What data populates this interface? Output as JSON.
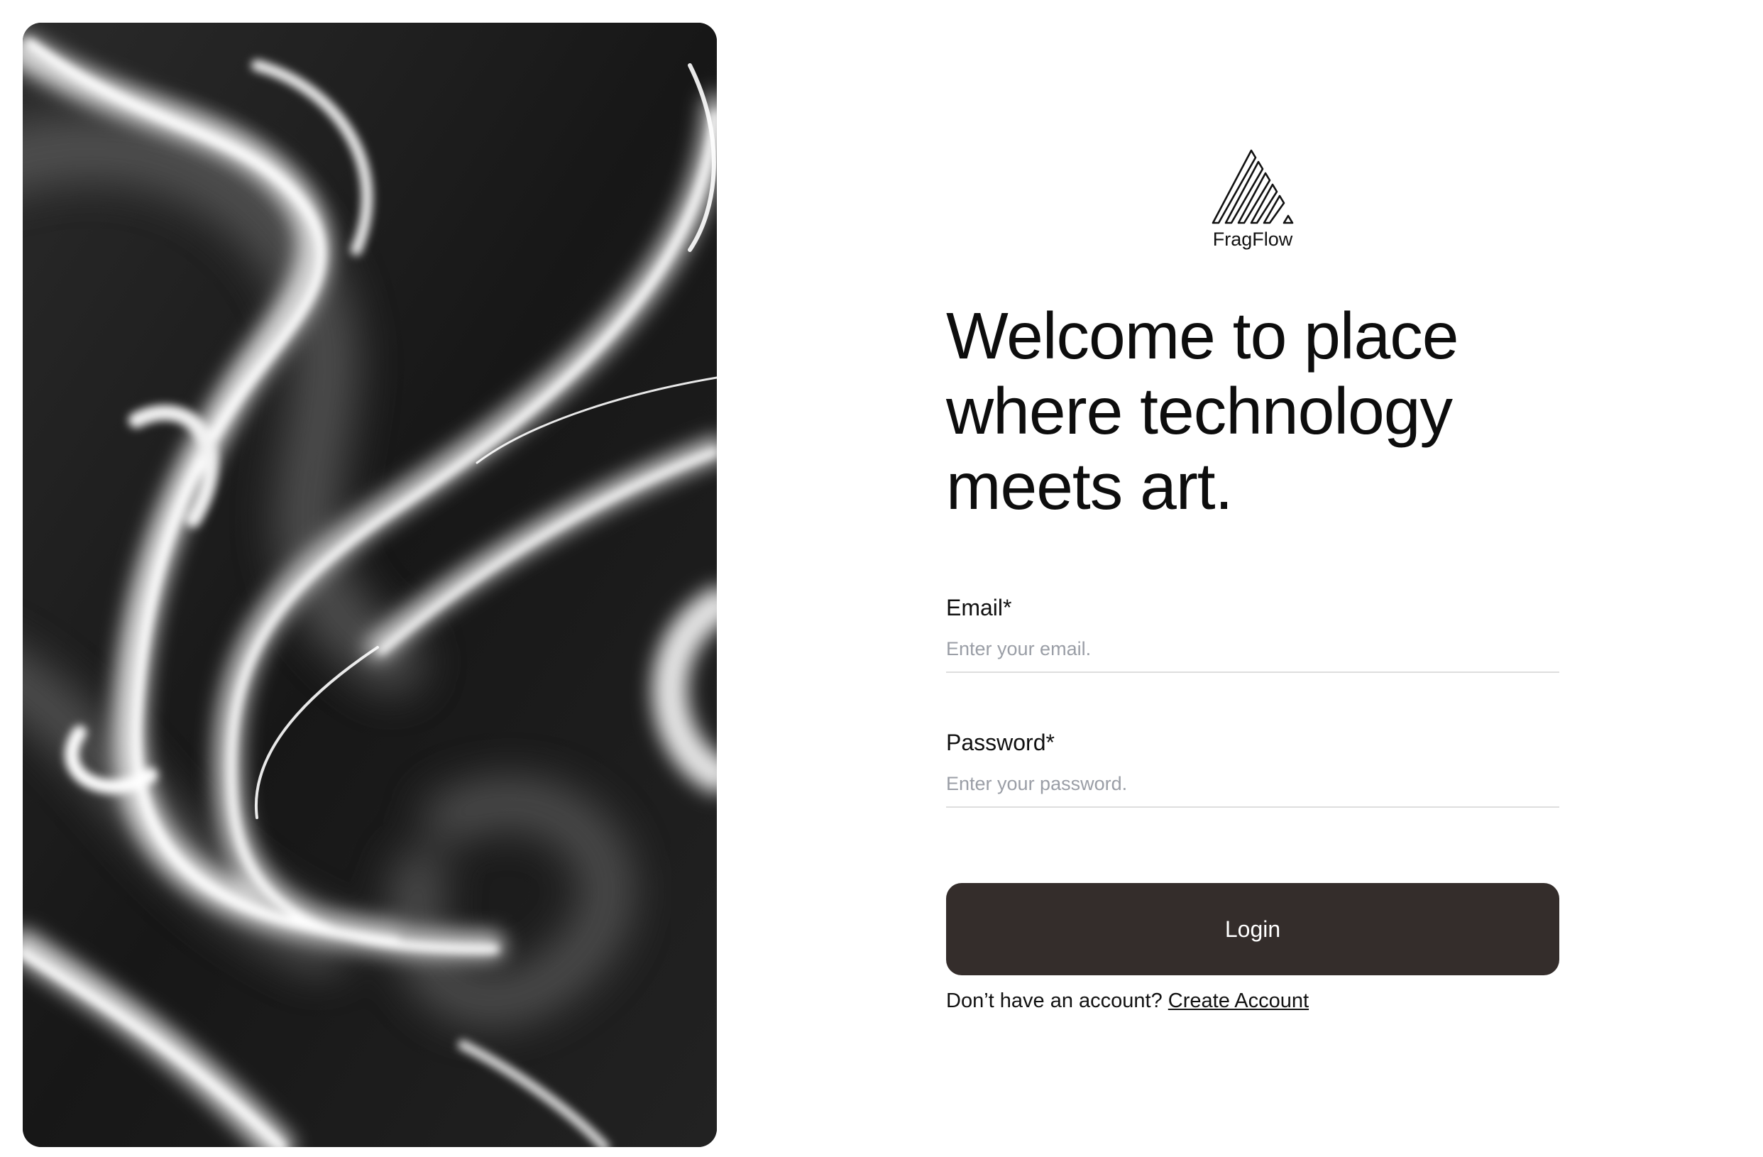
{
  "brand": {
    "name": "FragFlow",
    "logo_icon": "triangle-stripes-logo-icon"
  },
  "headline": {
    "line1": "Welcome to place",
    "line2": "where technology",
    "line3": "meets art."
  },
  "form": {
    "email": {
      "label": "Email*",
      "placeholder": "Enter your email.",
      "value": ""
    },
    "password": {
      "label": "Password*",
      "placeholder": "Enter your password.",
      "value": ""
    },
    "login_label": "Login"
  },
  "signup": {
    "prompt": "Don’t have an account?",
    "link_label": "Create Account"
  },
  "colors": {
    "button_bg": "#342d2b",
    "art_bg": "#1c1c1c",
    "input_border": "#dedede",
    "placeholder": "#9a9ea6"
  }
}
